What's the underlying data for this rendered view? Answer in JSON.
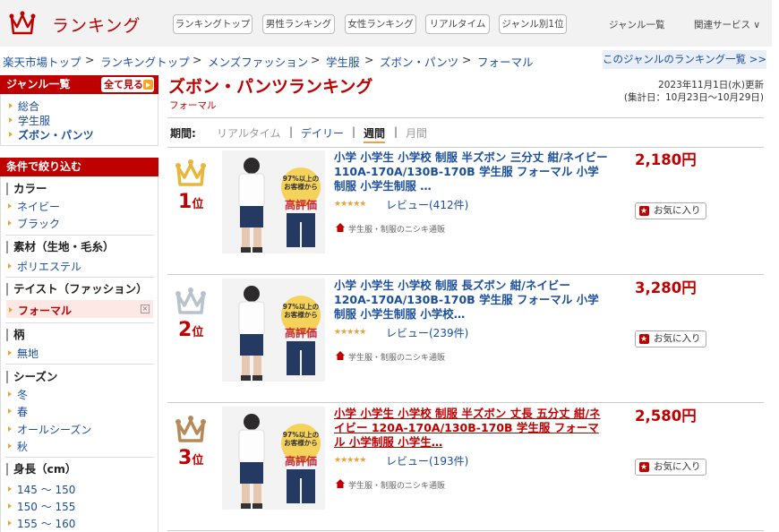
{
  "header": {
    "logo_text": "ランキング",
    "tabs": [
      "ランキングトップ",
      "男性ランキング",
      "女性ランキング",
      "リアルタイム",
      "ジャンル別1位"
    ],
    "genre_list": "ジャンル一覧",
    "related": "関連サービス ∨"
  },
  "breadcrumb": {
    "items": [
      "楽天市場トップ",
      "ランキングトップ",
      "メンズファッション",
      "学生服",
      "ズボン・パンツ",
      "フォーマル"
    ],
    "separator": ">",
    "genre_ranking_link": "このジャンルのランキング一覧 >>"
  },
  "sidebar": {
    "genre_header": "ジャンル一覧",
    "see_all": "全て見る",
    "genres": [
      "総合",
      "学生服",
      "ズボン・パンツ"
    ],
    "filter_header": "条件で絞り込む",
    "sections": [
      {
        "title": "カラー",
        "items": [
          "ネイビー",
          "ブラック"
        ]
      },
      {
        "title": "素材（生地・毛糸）",
        "items": [
          "ポリエステル"
        ]
      },
      {
        "title": "テイスト（ファッション）",
        "items": [
          "フォーマル"
        ]
      },
      {
        "title": "柄",
        "items": [
          "無地"
        ]
      },
      {
        "title": "シーズン",
        "items": [
          "冬",
          "春",
          "オールシーズン",
          "秋"
        ]
      },
      {
        "title": "身長（cm）",
        "items": [
          "145 ～ 150",
          "150 ～ 155",
          "155 ～ 160"
        ]
      }
    ],
    "clear_x": "×"
  },
  "main": {
    "title": "ズボン・パンツランキング",
    "subtitle": "フォーマル",
    "updated": "2023年11月1日(水)更新",
    "period_range": "(集計日：10月23日～10月29日)",
    "period_label": "期間:",
    "periods": [
      "リアルタイム",
      "デイリー",
      "週間",
      "月間"
    ],
    "period_sep": "|"
  },
  "items": [
    {
      "rank": "1",
      "rank_suffix": "位",
      "title": "小学 小学生 小学校 制服 半ズボン 三分丈 紺/ネイビー 110A-170A/130B-170B 学生服 フォーマル 小学制服 小学生制服 …",
      "stars": "★★★★★",
      "review": "レビュー(412件)",
      "shop": "学生服・制服のニシキ通販",
      "price": "2,180円",
      "fav": "お気に入り",
      "crown_color": "#e5b73b",
      "badge": "97%以上のお客様から",
      "badge_main": "高評価"
    },
    {
      "rank": "2",
      "rank_suffix": "位",
      "title": "小学 小学生 小学校 制服 長ズボン 紺/ネイビー 120A-170A/130B-170B 学生服 フォーマル 小学制服 小学生制服 小学校…",
      "stars": "★★★★★",
      "review": "レビュー(239件)",
      "shop": "学生服・制服のニシキ通販",
      "price": "3,280円",
      "fav": "お気に入り",
      "crown_color": "#b7c2cc",
      "badge": "97%以上のお客様から",
      "badge_main": "高評価"
    },
    {
      "rank": "3",
      "rank_suffix": "位",
      "title": "小学 小学生 小学校 制服 半ズボン 丈長 五分丈 紺/ネイビー 120A-170A/130B-170B 学生服 フォーマル 小学制服 小学生…",
      "stars": "★★★★★",
      "review": "レビュー(193件)",
      "shop": "学生服・制服のニシキ通販",
      "price": "2,580円",
      "fav": "お気に入り",
      "crown_color": "#b5895a",
      "badge": "97%以上のお客様から",
      "badge_main": "高評価"
    }
  ]
}
